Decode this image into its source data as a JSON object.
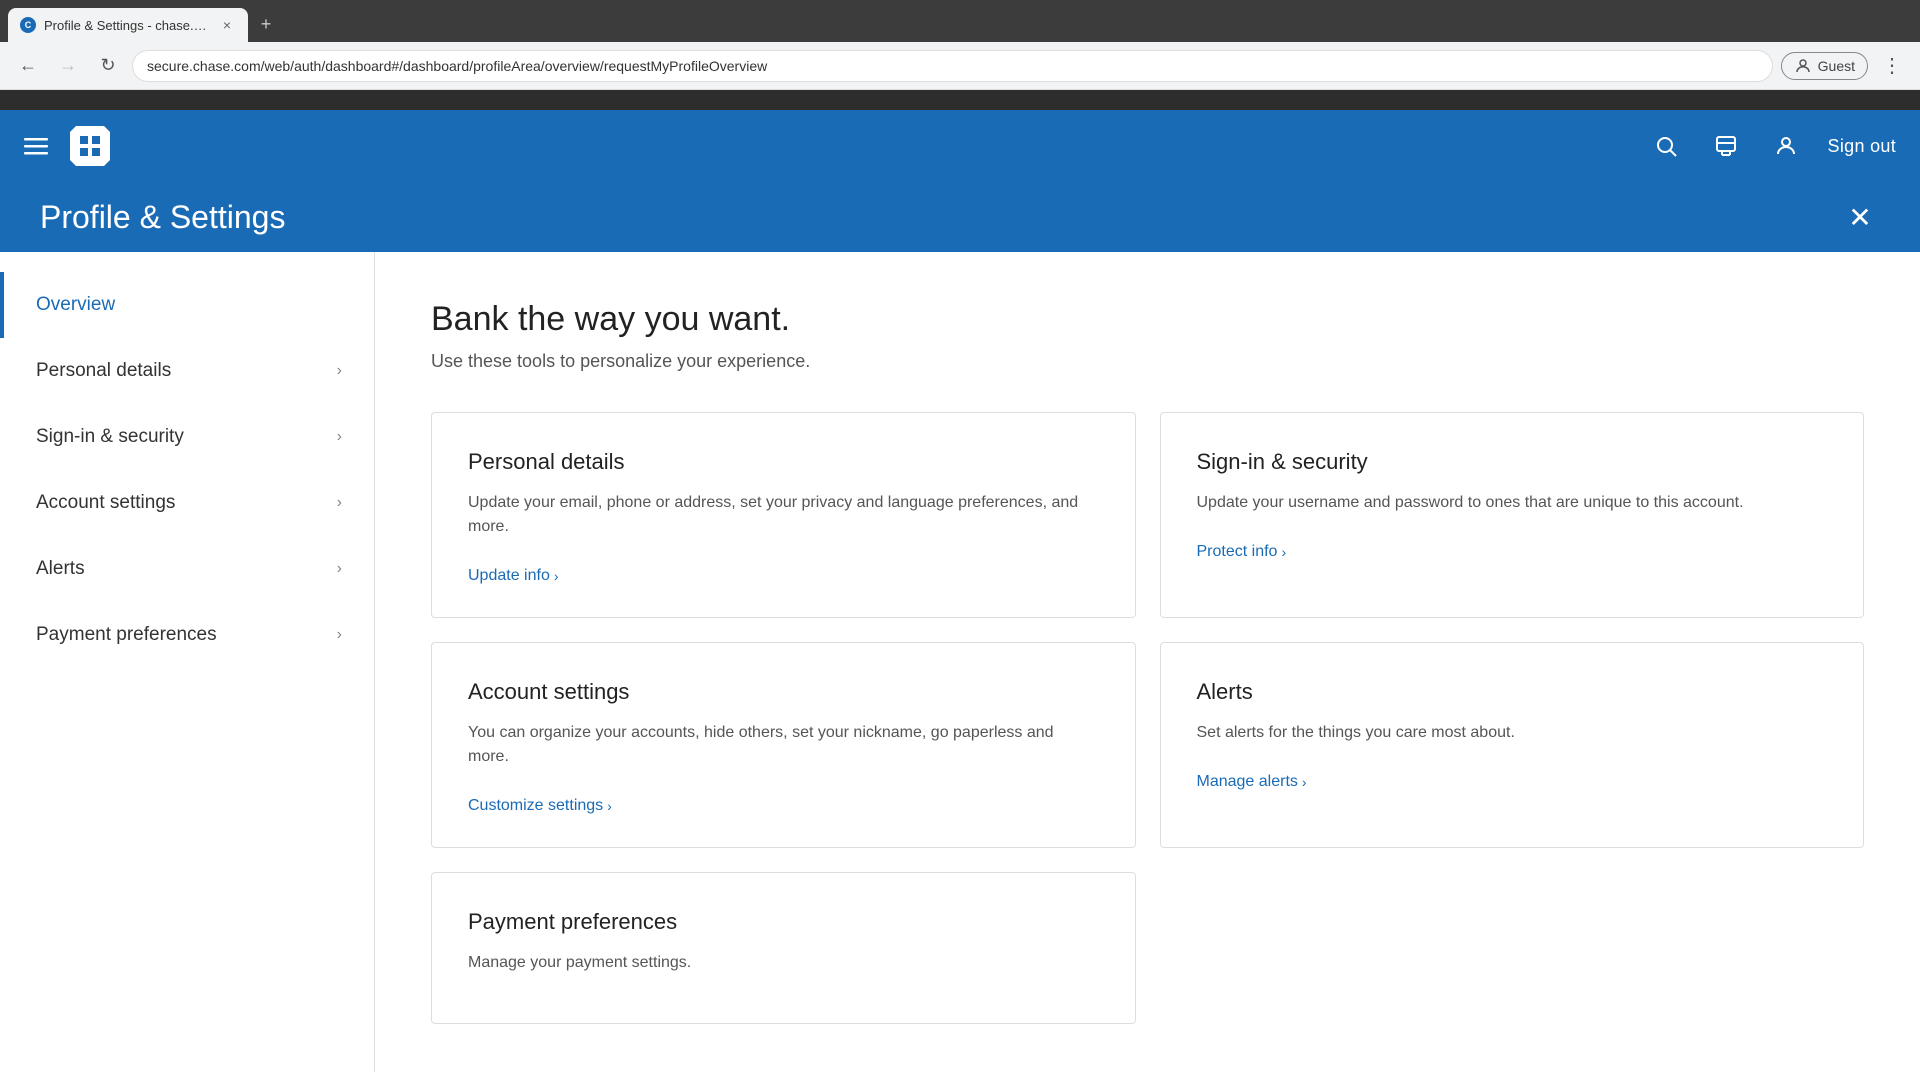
{
  "browser": {
    "tab_title": "Profile & Settings - chase.com",
    "close_label": "×",
    "new_tab_label": "+",
    "url": "secure.chase.com/web/auth/dashboard#/dashboard/profileArea/overview/requestMyProfileOverview",
    "back_disabled": false,
    "forward_disabled": true,
    "profile_label": "Guest",
    "menu_dots": "⋮"
  },
  "header": {
    "sign_out_label": "Sign out"
  },
  "page": {
    "title": "Profile & Settings",
    "close_label": "✕"
  },
  "sidebar": {
    "items": [
      {
        "id": "overview",
        "label": "Overview",
        "has_chevron": false,
        "active": true
      },
      {
        "id": "personal-details",
        "label": "Personal details",
        "has_chevron": true,
        "active": false
      },
      {
        "id": "sign-in-security",
        "label": "Sign-in & security",
        "has_chevron": true,
        "active": false
      },
      {
        "id": "account-settings",
        "label": "Account settings",
        "has_chevron": true,
        "active": false
      },
      {
        "id": "alerts",
        "label": "Alerts",
        "has_chevron": true,
        "active": false
      },
      {
        "id": "payment-preferences",
        "label": "Payment preferences",
        "has_chevron": true,
        "active": false
      }
    ]
  },
  "content": {
    "heading": "Bank the way you want.",
    "subheading": "Use these tools to personalize your experience.",
    "cards": [
      {
        "id": "personal-details",
        "title": "Personal details",
        "description": "Update your email, phone or address, set your privacy and language preferences, and more.",
        "link_text": "Update info",
        "link_chevron": "›"
      },
      {
        "id": "sign-in-security",
        "title": "Sign-in & security",
        "description": "Update your username and password to ones that are unique to this account.",
        "link_text": "Protect info",
        "link_chevron": "›"
      },
      {
        "id": "account-settings",
        "title": "Account settings",
        "description": "You can organize your accounts, hide others, set your nickname, go paperless and more.",
        "link_text": "Customize settings",
        "link_chevron": "›"
      },
      {
        "id": "alerts",
        "title": "Alerts",
        "description": "Set alerts for the things you care most about.",
        "link_text": "Manage alerts",
        "link_chevron": "›"
      }
    ],
    "partial_card": {
      "id": "payment-preferences",
      "title": "Payment preferences",
      "description": "Manage your payment settings."
    }
  }
}
